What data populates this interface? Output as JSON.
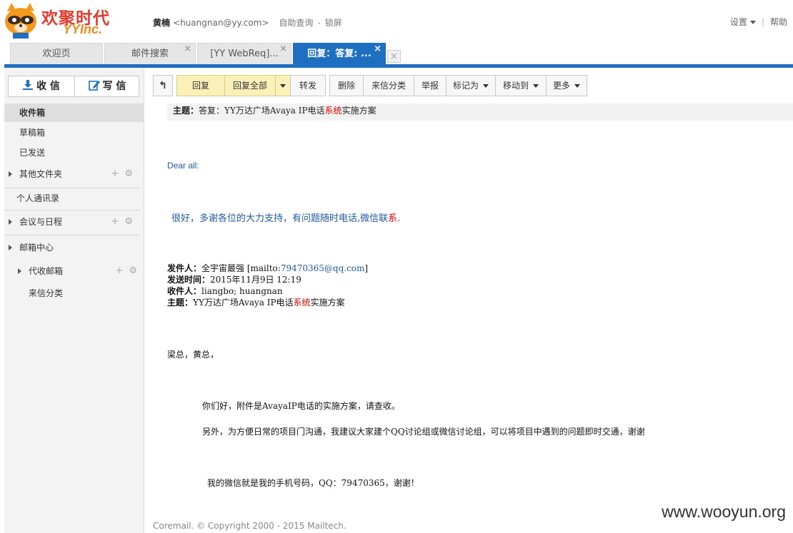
{
  "brand": {
    "name_cn": "欢聚时代",
    "name_en": "YYInc."
  },
  "user": {
    "name": "黄楠",
    "email": "<huangnan@yy.com>",
    "self_query": "自助查询",
    "separator": "-",
    "lock": "锁屏"
  },
  "top_right": {
    "settings": "设置",
    "help": "帮助"
  },
  "tabs": [
    {
      "label": "欢迎页",
      "closable": false
    },
    {
      "label": "邮件搜索",
      "closable": true
    },
    {
      "label": "[YY WebReq]...",
      "closable": true
    },
    {
      "label": "回复：答复: ...",
      "closable": true,
      "active": true
    }
  ],
  "tab_close_glyph": "×",
  "sidebar": {
    "receive_label": "收 信",
    "write_label": "写 信",
    "items": [
      {
        "label": "收件箱"
      },
      {
        "label": "草稿箱"
      },
      {
        "label": "已发送"
      },
      {
        "label": "其他文件夹"
      },
      {
        "label": "个人通讯录"
      },
      {
        "label": "会议与日程"
      },
      {
        "label": "邮箱中心"
      },
      {
        "label": "代收邮箱"
      },
      {
        "label": "来信分类"
      }
    ],
    "plus_glyph": "+",
    "gear_glyph": "⚙"
  },
  "toolbar": {
    "back_glyph": "↰",
    "reply": "回复",
    "reply_all": "回复全部",
    "forward": "转发",
    "delete": "删除",
    "classify": "来信分类",
    "report": "举报",
    "mark_as": "标记为",
    "move_to": "移动到",
    "more": "更多"
  },
  "message": {
    "subject_label": "主题：",
    "subject_prefix": "答复：YY万达广场Avaya IP电话",
    "subject_red": "系统",
    "subject_suffix": "实施方案",
    "greeting": "Dear all:",
    "reply_body_prefix": "很好，多谢各位的大力支持，有问题随时电话,微信联",
    "reply_body_red": "系",
    "reply_body_suffix": ".",
    "quoted": {
      "from_label": "发件人：",
      "from_name": "全宇宙最强 [mailto:",
      "from_email": "79470365@qq.com",
      "from_close": "]",
      "sent_label": "发送时间：",
      "sent_value": "2015年11月9日 12:19",
      "to_label": "收件人：",
      "to_value": "liangbo; huangnan",
      "subject_label": "主题：",
      "subject_prefix": "YY万达广场Avaya IP电话",
      "subject_red": "系统",
      "subject_suffix": "实施方案"
    },
    "salutation": "梁总，黄总，",
    "para1": "你们好，附件是AvayaIP电话的实施方案，请查收。",
    "para2": "另外，为方便日常的项目门沟通，我建议大家建个QQ讨论组或微信讨论组，可以将项目中遇到的问题即时交通，谢谢",
    "para3": "我的微信就是我的手机号码，QQ：79470365，谢谢！"
  },
  "footer": {
    "copyright": "Coremail. © Copyright 2000 - 2015 Mailtech."
  },
  "watermark": "www.wooyun.org"
}
